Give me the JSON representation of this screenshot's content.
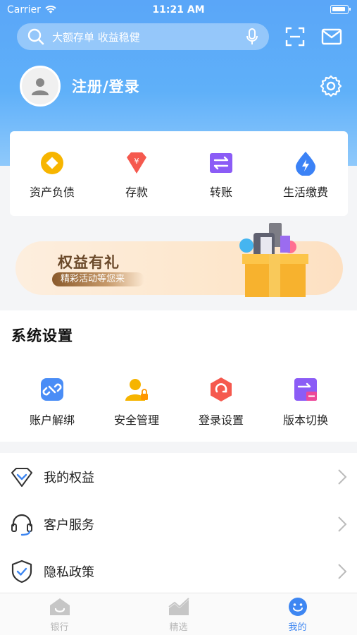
{
  "status_bar": {
    "carrier": "Carrier",
    "time": "11:21 AM"
  },
  "search": {
    "placeholder": "大额存单 收益稳健"
  },
  "profile": {
    "login_label": "注册/登录"
  },
  "quick_actions": [
    {
      "label": "资产负债",
      "icon": "coin-icon",
      "color": "#f6b400"
    },
    {
      "label": "存款",
      "icon": "gem-icon",
      "color": "#f5594e"
    },
    {
      "label": "转账",
      "icon": "transfer-icon",
      "color": "#8b5cf6"
    },
    {
      "label": "生活缴费",
      "icon": "water-drop-icon",
      "color": "#3b82f6"
    }
  ],
  "banner": {
    "title": "权益有礼",
    "subtitle": "精彩活动等您来"
  },
  "system_settings": {
    "title": "系统设置",
    "items": [
      {
        "label": "账户解绑",
        "icon": "unlink-icon"
      },
      {
        "label": "安全管理",
        "icon": "security-person-icon"
      },
      {
        "label": "登录设置",
        "icon": "login-settings-icon"
      },
      {
        "label": "版本切换",
        "icon": "version-switch-icon"
      }
    ]
  },
  "menu": [
    {
      "label": "我的权益",
      "icon": "diamond-outline-icon"
    },
    {
      "label": "客户服务",
      "icon": "headset-icon"
    },
    {
      "label": "隐私政策",
      "icon": "shield-check-icon"
    }
  ],
  "tabs": [
    {
      "label": "银行",
      "icon": "bank-icon",
      "active": false
    },
    {
      "label": "精选",
      "icon": "chart-icon",
      "active": false
    },
    {
      "label": "我的",
      "icon": "smiley-icon",
      "active": true
    }
  ],
  "colors": {
    "accent": "#3d86f2",
    "header": "#5aa6f8"
  }
}
